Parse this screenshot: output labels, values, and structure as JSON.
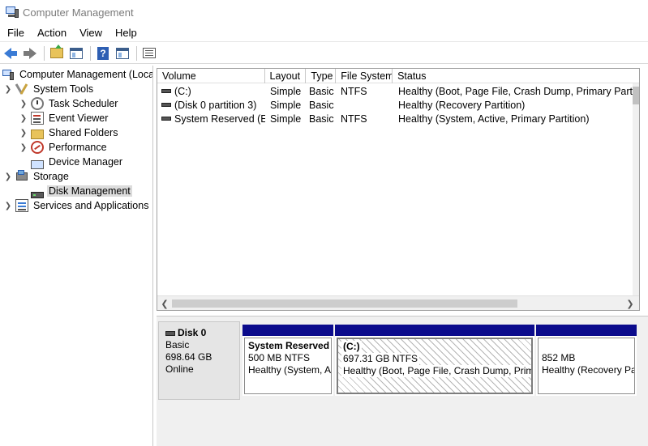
{
  "window": {
    "title": "Computer Management"
  },
  "menu": [
    "File",
    "Action",
    "View",
    "Help"
  ],
  "toolbar": {
    "buttons": [
      "back-arrow-icon",
      "forward-arrow-icon",
      "up-folder-icon",
      "show-hide-tree-icon",
      "help-icon",
      "show-hide-action-pane-icon",
      "properties-icon"
    ]
  },
  "tree": {
    "root": "Computer Management (Local",
    "system_tools": "System Tools",
    "task_scheduler": "Task Scheduler",
    "event_viewer": "Event Viewer",
    "shared_folders": "Shared Folders",
    "performance": "Performance",
    "device_manager": "Device Manager",
    "storage": "Storage",
    "disk_management": "Disk Management",
    "services": "Services and Applications"
  },
  "volumes": {
    "columns": [
      "Volume",
      "Layout",
      "Type",
      "File System",
      "Status"
    ],
    "rows": [
      {
        "volume": "(C:)",
        "layout": "Simple",
        "type": "Basic",
        "fs": "NTFS",
        "status": "Healthy (Boot, Page File, Crash Dump, Primary Partition)"
      },
      {
        "volume": "(Disk 0 partition 3)",
        "layout": "Simple",
        "type": "Basic",
        "fs": "",
        "status": "Healthy (Recovery Partition)"
      },
      {
        "volume": "System Reserved (E:)",
        "layout": "Simple",
        "type": "Basic",
        "fs": "NTFS",
        "status": "Healthy (System, Active, Primary Partition)"
      }
    ]
  },
  "disk": {
    "name": "Disk 0",
    "type": "Basic",
    "size": "698.64 GB",
    "state": "Online",
    "partitions": [
      {
        "title": "System Reserved",
        "size": "500 MB NTFS",
        "status": "Healthy (System, A"
      },
      {
        "title": "(C:)",
        "size": "697.31 GB NTFS",
        "status": "Healthy (Boot, Page File, Crash Dump, Prima"
      },
      {
        "title": "",
        "size": "852 MB",
        "status": "Healthy (Recovery Pa"
      }
    ]
  },
  "colors": {
    "partition_bar": "#0b0b8c",
    "selection": "#dcdcdc"
  }
}
